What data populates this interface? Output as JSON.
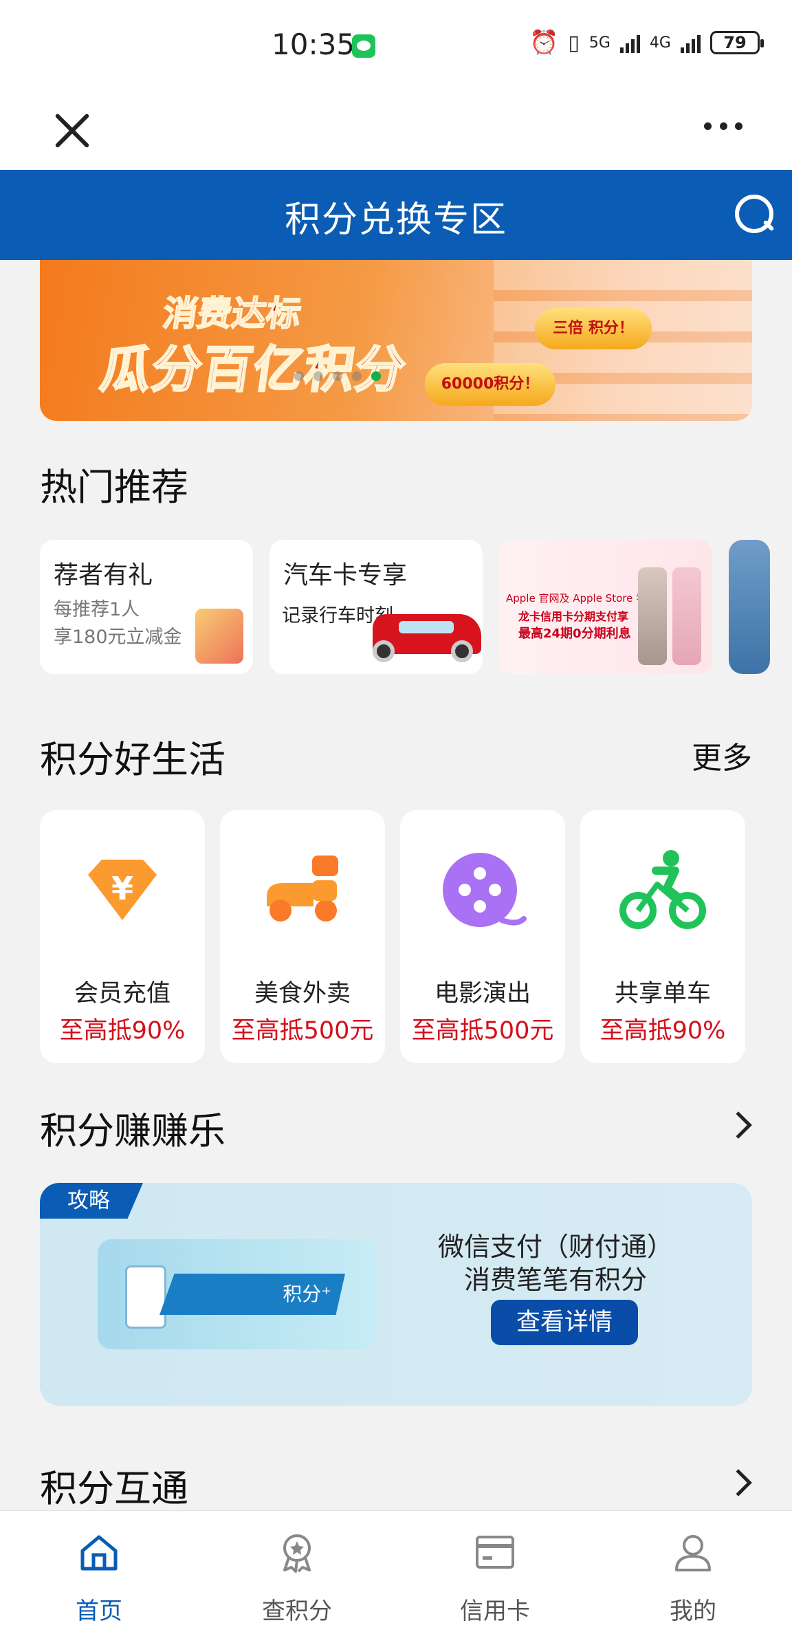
{
  "status_bar": {
    "time": "10:35",
    "network1": "5G",
    "network2": "4G",
    "battery": "79"
  },
  "titlebar": {
    "title": "积分兑换专区"
  },
  "banner": {
    "line1": "消费达标",
    "line2": "瓜分百亿积分",
    "tag1": "三倍 积分！",
    "tag2": "60000积分！"
  },
  "hot": {
    "title": "热门推荐",
    "cards": [
      {
        "title": "荐者有礼",
        "sub1": "每推荐1人",
        "sub2": "享180元立减金"
      },
      {
        "title": "汽车卡专享",
        "sub": "记录行车时刻"
      },
      {
        "line1": "Apple 官网及 Apple Store 零售店",
        "line2": "龙卡信用卡分期支付享",
        "line3": "最高24期0分期利息"
      }
    ]
  },
  "life": {
    "title": "积分好生活",
    "more": "更多",
    "items": [
      {
        "name": "会员充值",
        "discount": "至高抵90%"
      },
      {
        "name": "美食外卖",
        "discount": "至高抵500元"
      },
      {
        "name": "电影演出",
        "discount": "至高抵500元"
      },
      {
        "name": "共享单车",
        "discount": "至高抵90%"
      }
    ]
  },
  "earn": {
    "title": "积分赚赚乐",
    "badge": "攻略",
    "image_text": "积分⁺",
    "line1": "微信支付（财付通）",
    "line2": "消费笔笔有积分",
    "button": "查看详情"
  },
  "exchange": {
    "title": "积分互通"
  },
  "tabs": [
    {
      "label": "首页",
      "icon": "home-icon"
    },
    {
      "label": "查积分",
      "icon": "award-icon"
    },
    {
      "label": "信用卡",
      "icon": "card-icon"
    },
    {
      "label": "我的",
      "icon": "user-icon"
    }
  ],
  "colors": {
    "brand": "#0a5cb4",
    "discount": "#d3101c"
  }
}
